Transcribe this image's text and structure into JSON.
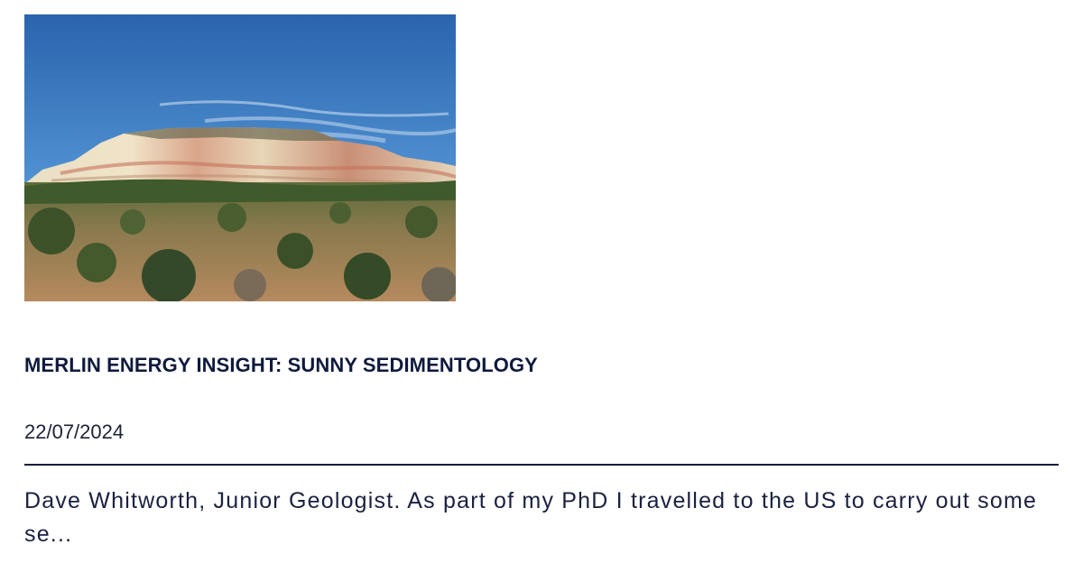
{
  "article": {
    "title": "MERLIN ENERGY INSIGHT: SUNNY SEDIMENTOLOGY",
    "date": "22/07/2024",
    "excerpt": "Dave Whitworth, Junior Geologist. As part of my PhD I travelled to the US to carry out some se..."
  },
  "colors": {
    "title": "#0f1a3d",
    "text": "#1b2140",
    "divider": "#151c3d",
    "sky": "#2f6db5"
  }
}
